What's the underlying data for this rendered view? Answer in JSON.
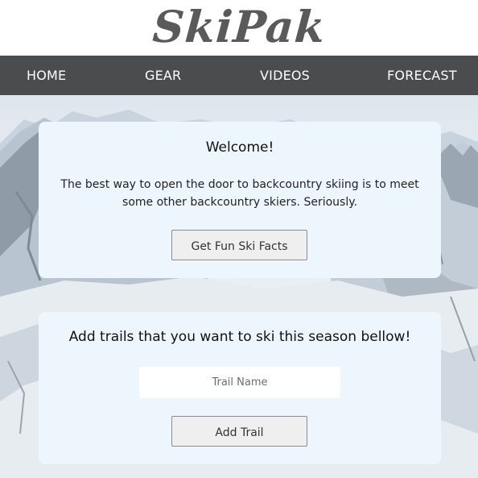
{
  "logo": {
    "text": "SkiPak"
  },
  "nav": {
    "items": [
      {
        "label": "HOME"
      },
      {
        "label": "GEAR"
      },
      {
        "label": "VIDEOS"
      },
      {
        "label": "FORECAST"
      }
    ]
  },
  "welcome": {
    "title": "Welcome!",
    "body": "The best way to open the door to backcountry skiing is to meet some other backcountry skiers. Seriously.",
    "button_label": "Get Fun Ski Facts"
  },
  "trails": {
    "title": "Add trails that you want to ski this season bellow!",
    "input_placeholder": "Trail Name",
    "input_value": "",
    "button_label": "Add Trail"
  },
  "colors": {
    "nav_background": "#4a4c4e",
    "card_background": "#eef6fd",
    "logo": "#5a5a5a"
  }
}
